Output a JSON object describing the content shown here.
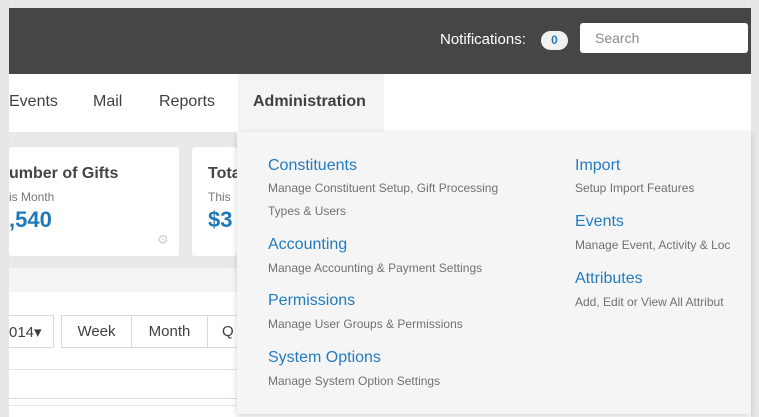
{
  "topbar": {
    "notifications_label": "Notifications:",
    "notifications_count": "0",
    "search_placeholder": "Search"
  },
  "nav": {
    "items": [
      "Events",
      "Mail",
      "Reports",
      "Administration"
    ]
  },
  "stats": {
    "card1": {
      "title": "umber of Gifts",
      "subtitle": "is Month",
      "value": ",540"
    },
    "card2": {
      "title": "Tota",
      "subtitle": "This",
      "value": "$3"
    }
  },
  "toolbar": {
    "year_label": "014▾",
    "buttons": [
      "Week",
      "Month",
      "Q"
    ]
  },
  "admin_menu": {
    "left": [
      {
        "title": "Constituents",
        "desc1": "Manage Constituent Setup, Gift Processing",
        "desc2": "Types & Users"
      },
      {
        "title": "Accounting",
        "desc1": "Manage Accounting & Payment Settings"
      },
      {
        "title": "Permissions",
        "desc1": "Manage User Groups & Permissions"
      },
      {
        "title": "System Options",
        "desc1": "Manage System Option Settings"
      }
    ],
    "right": [
      {
        "title": "Import",
        "desc1": "Setup Import Features"
      },
      {
        "title": "Events",
        "desc1": "Manage Event, Activity & Loc"
      },
      {
        "title": "Attributes",
        "desc1": "Add, Edit or View All Attribut"
      }
    ]
  },
  "colors": {
    "topbar_bg": "#464646",
    "accent_blue": "#237bc0",
    "value_blue": "#1f79b9",
    "badge_text": "#2f7bbf",
    "dropdown_bg": "#f5f5f5"
  }
}
